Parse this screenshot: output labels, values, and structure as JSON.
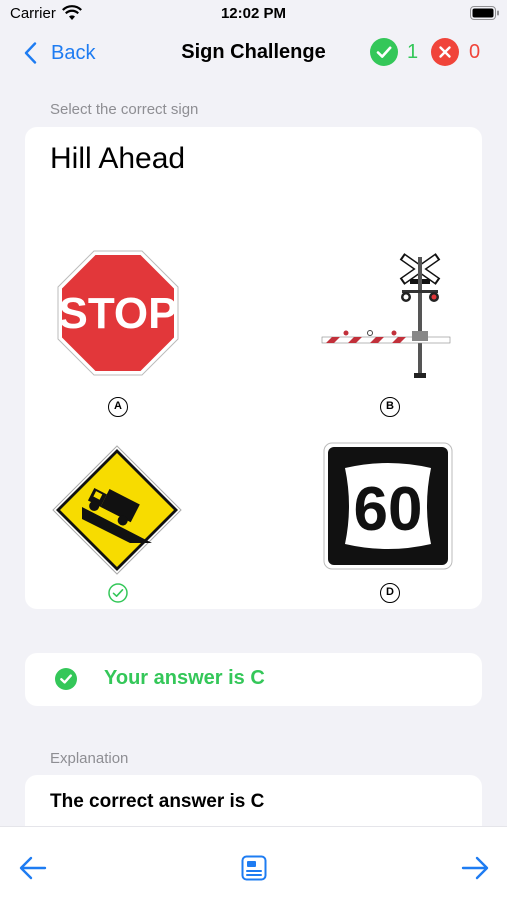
{
  "status": {
    "carrier": "Carrier",
    "time": "12:02 PM"
  },
  "nav": {
    "back_label": "Back",
    "title": "Sign Challenge",
    "correct_count": "1",
    "wrong_count": "0"
  },
  "question": {
    "prompt": "Select the correct sign",
    "title": "Hill Ahead",
    "options": [
      {
        "letter": "A",
        "sign_text": "STOP",
        "icon": "stop-sign"
      },
      {
        "letter": "B",
        "icon": "railroad-crossing-gate-sign"
      },
      {
        "letter": "C",
        "icon": "hill-ahead-truck-sign",
        "selected_correct": true
      },
      {
        "letter": "D",
        "sign_text": "60",
        "icon": "route-60-shield-sign"
      }
    ]
  },
  "answer": {
    "text": "Your answer is C"
  },
  "explanation": {
    "label": "Explanation",
    "text": "The correct answer is C"
  },
  "colors": {
    "accent": "#1E7CF2",
    "correct": "#34C759",
    "wrong": "#F0443A",
    "stop_red": "#E2373A",
    "warning_yellow": "#F7DC00"
  }
}
